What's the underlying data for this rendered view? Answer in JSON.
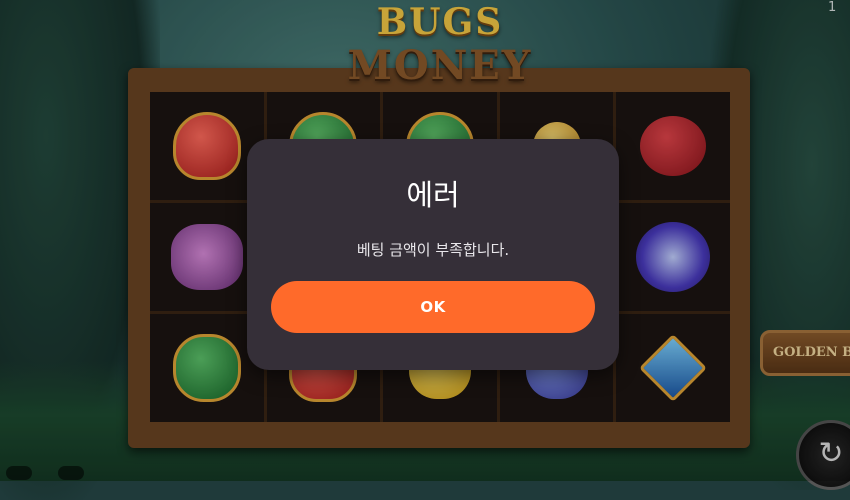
{
  "game": {
    "logo_line1": "BUGS",
    "logo_line2": "MONEY",
    "side_badge": "GOLDEN B",
    "corner_text": "1",
    "spin_icon": "↻"
  },
  "reels": [
    [
      "heart",
      "spade",
      "spade",
      "coin",
      "ladybug"
    ],
    [
      "butterfly",
      "",
      "",
      "",
      "flower"
    ],
    [
      "club",
      "heart",
      "lemon",
      "mix",
      "diamond"
    ]
  ],
  "dialog": {
    "title": "에러",
    "message": "베팅 금액이 부족합니다.",
    "ok_label": "OK"
  },
  "colors": {
    "dialog_bg": "#352f38",
    "ok_button": "#ff6a2a",
    "frame": "#6a4423"
  }
}
